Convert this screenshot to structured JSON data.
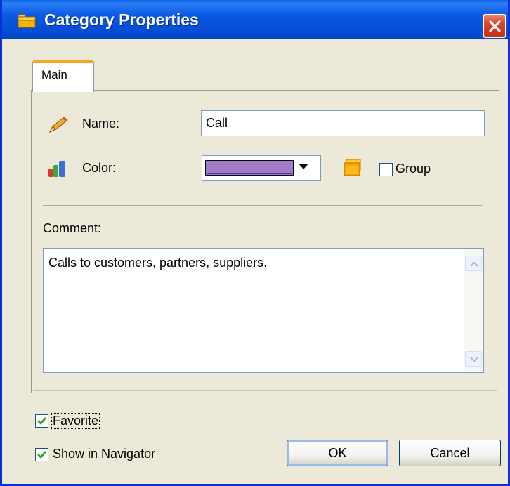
{
  "window": {
    "title": "Category Properties"
  },
  "tabs": [
    {
      "label": "Main",
      "selected": true
    }
  ],
  "form": {
    "name_label": "Name:",
    "name_value": "Call",
    "color_label": "Color:",
    "color_value": "#a07cc8",
    "group_label": "Group",
    "group_checked": false,
    "comment_label": "Comment:",
    "comment_value": "Calls to customers, partners, suppliers."
  },
  "options": {
    "favorite_label": "Favorite",
    "favorite_checked": true,
    "show_navigator_label": "Show in Navigator",
    "show_navigator_checked": true
  },
  "buttons": {
    "ok_label": "OK",
    "cancel_label": "Cancel"
  },
  "icons": {
    "title": "folder-icon",
    "close": "close-icon",
    "name": "pencil-icon",
    "color": "color-bars-icon",
    "color_picker": "folder-icon"
  },
  "colors": {
    "titlebar": "#0a58e2",
    "accent_tab": "#f5a623",
    "close_button": "#d8462a"
  }
}
